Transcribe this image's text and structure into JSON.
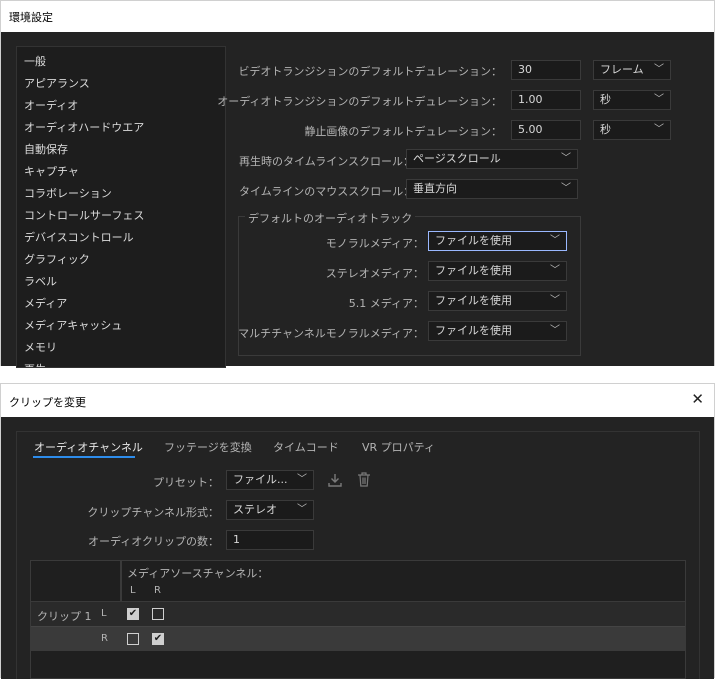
{
  "prefs": {
    "title": "環境設定",
    "categories": [
      "一般",
      "アピアランス",
      "オーディオ",
      "オーディオハードウエア",
      "自動保存",
      "キャプチャ",
      "コラボレーション",
      "コントロールサーフェス",
      "デバイスコントロール",
      "グラフィック",
      "ラベル",
      "メディア",
      "メディアキャッシュ",
      "メモリ",
      "再生"
    ],
    "video_transition": {
      "label": "ビデオトランジションのデフォルトデュレーション：",
      "value": "30",
      "unit": "フレーム"
    },
    "audio_transition": {
      "label": "オーディオトランジションのデフォルトデュレーション：",
      "value": "1.00",
      "unit": "秒"
    },
    "still_image": {
      "label": "静止画像のデフォルトデュレーション：",
      "value": "5.00",
      "unit": "秒"
    },
    "playback_scroll": {
      "label": "再生時のタイムラインスクロール：",
      "value": "ページスクロール"
    },
    "mouse_scroll": {
      "label": "タイムラインのマウススクロール：",
      "value": "垂直方向"
    },
    "audio_tracks": {
      "legend": "デフォルトのオーディオトラック",
      "mono": {
        "label": "モノラルメディア：",
        "value": "ファイルを使用"
      },
      "stereo": {
        "label": "ステレオメディア：",
        "value": "ファイルを使用"
      },
      "surround": {
        "label": "5.1 メディア：",
        "value": "ファイルを使用"
      },
      "multi": {
        "label": "マルチチャンネルモノラルメディア：",
        "value": "ファイルを使用"
      }
    }
  },
  "modify": {
    "title": "クリップを変更",
    "close_glyph": "✕",
    "tabs": [
      "オーディオチャンネル",
      "フッテージを変換",
      "タイムコード",
      "VR プロパティ"
    ],
    "preset": {
      "label": "プリセット：",
      "value": "ファイル..."
    },
    "channel_format": {
      "label": "クリップチャンネル形式：",
      "value": "ステレオ"
    },
    "clip_count": {
      "label": "オーディオクリップの数：",
      "value": "1"
    },
    "table": {
      "header": "メディアソースチャンネル：",
      "cols": [
        "L",
        "R"
      ],
      "clip_label": "クリップ 1",
      "rows": [
        {
          "ch": "L",
          "checks": [
            true,
            false
          ]
        },
        {
          "ch": "R",
          "checks": [
            false,
            true
          ]
        }
      ]
    }
  }
}
